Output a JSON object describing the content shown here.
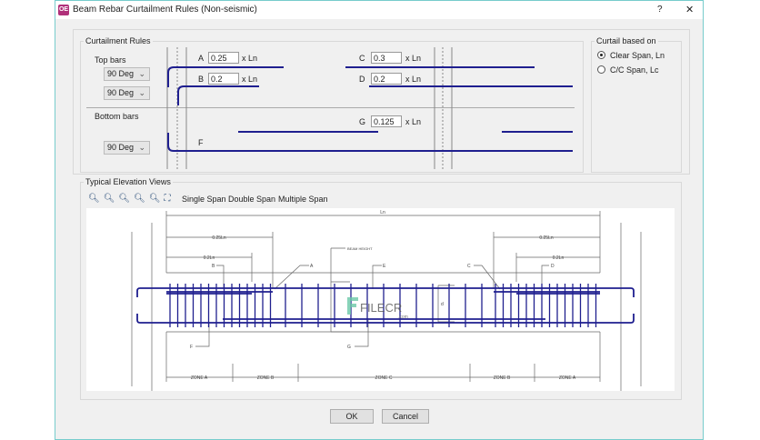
{
  "window": {
    "title": "Beam Rebar Curtailment Rules (Non-seismic)",
    "app_icon": "OE",
    "help": "?",
    "close": "✕"
  },
  "curtailment": {
    "group_label": "Curtailment Rules",
    "top_bars_label": "Top bars",
    "bottom_bars_label": "Bottom bars",
    "top_hook_1": "90 Deg",
    "top_hook_2": "90 Deg",
    "bottom_hook": "90 Deg",
    "fields": [
      {
        "label": "A",
        "value": "0.25",
        "unit": "x Ln"
      },
      {
        "label": "B",
        "value": "0.2",
        "unit": "x Ln"
      },
      {
        "label": "C",
        "value": "0.3",
        "unit": "x Ln"
      },
      {
        "label": "D",
        "value": "0.2",
        "unit": "x Ln"
      },
      {
        "label": "G",
        "value": "0.125",
        "unit": "x Ln"
      }
    ],
    "f_label": "F"
  },
  "curtail_based_on": {
    "group_label": "Curtail based on",
    "options": [
      {
        "label": "Clear Span, Ln",
        "selected": true
      },
      {
        "label": "C/C Span, Lc",
        "selected": false
      }
    ]
  },
  "elevation": {
    "group_label": "Typical Elevation Views",
    "toolbar": [
      "zoom-in-icon",
      "zoom-window-icon",
      "zoom-out-icon",
      "zoom-previous-icon",
      "zoom-extents-icon",
      "fit-view-icon"
    ],
    "tabs": [
      "Single Span",
      "Double Span",
      "Multiple Span"
    ],
    "drawing": {
      "ln": "Ln",
      "l025_left": "0.25Ln",
      "l02_left": "0.2Ln",
      "l025_right": "0.25Ln",
      "l02_right": "0.2Ln",
      "beam_height": "BEAM HEIGHT",
      "labels": {
        "A": "A",
        "B": "B",
        "C": "C",
        "D": "D",
        "E": "E",
        "F": "F",
        "G": "G",
        "d": "d"
      },
      "zones": [
        "ZONE A",
        "ZONE B",
        "ZONE C",
        "ZONE B",
        "ZONE A"
      ],
      "watermark": "FILECR",
      "watermark_sub": ".com"
    }
  },
  "buttons": {
    "ok": "OK",
    "cancel": "Cancel"
  },
  "colors": {
    "rebar": "#1f1f8f",
    "accent": "#7cc"
  }
}
